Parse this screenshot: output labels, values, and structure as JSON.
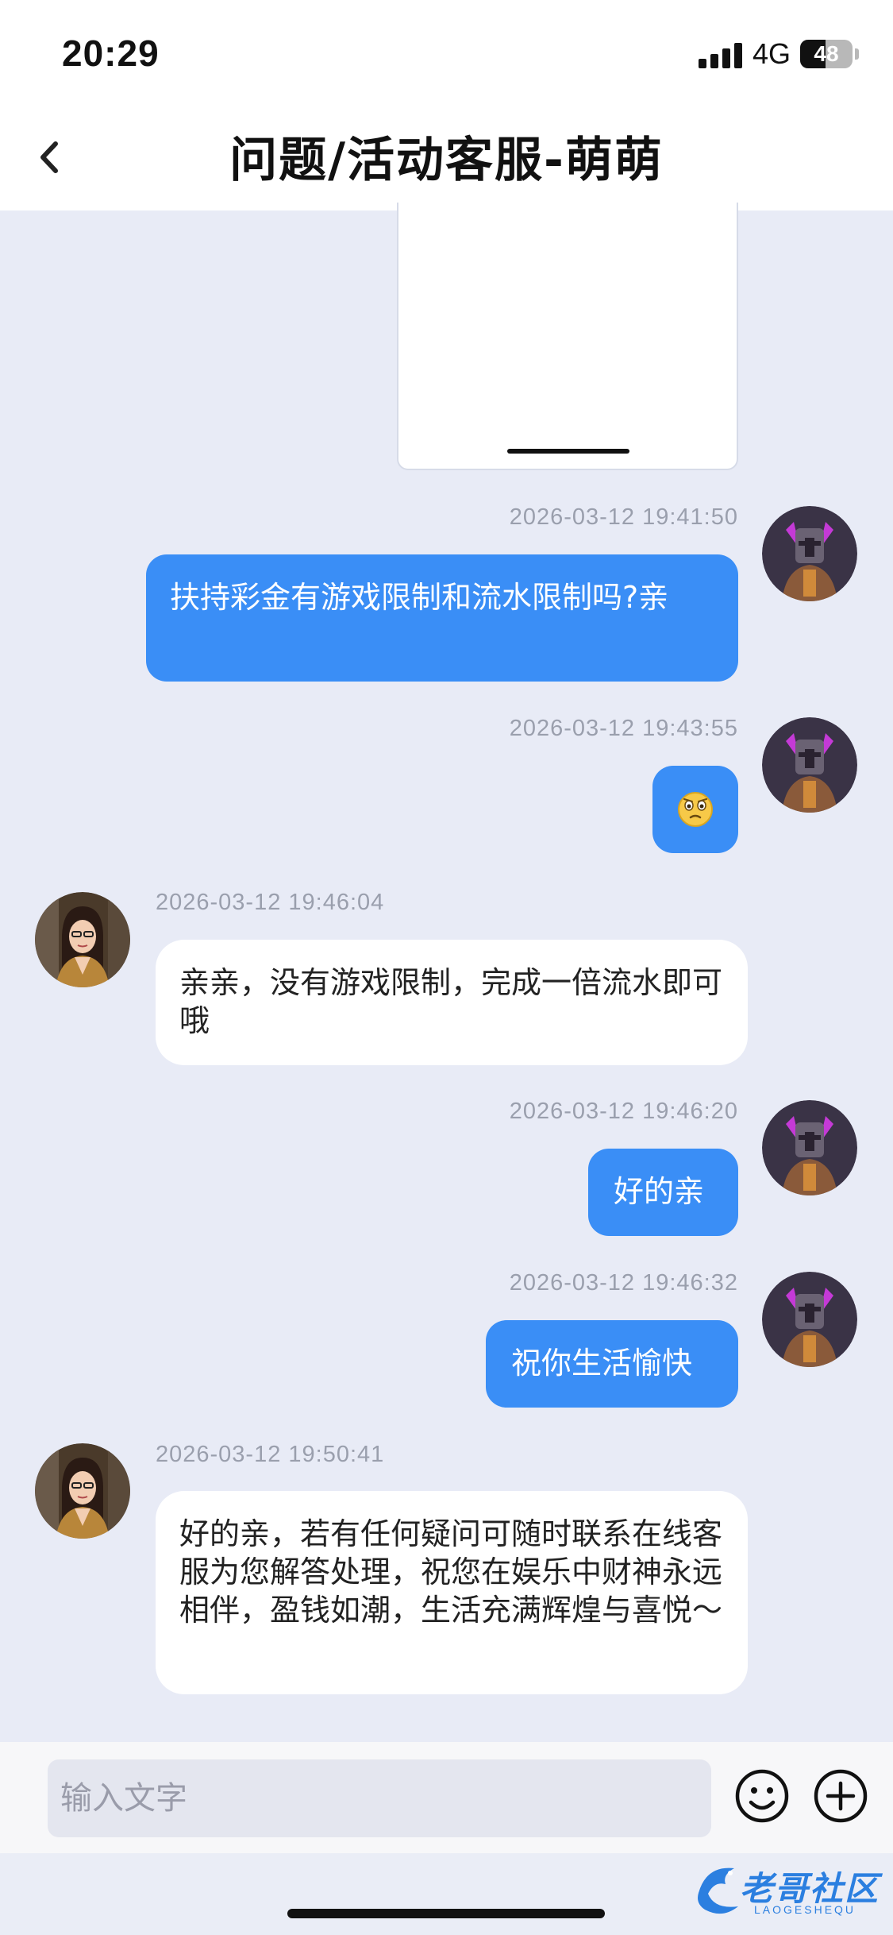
{
  "status_bar": {
    "time": "20:29",
    "network": "4G",
    "battery": "48",
    "battery_level": 0.48
  },
  "header": {
    "title": "问题/活动客服-萌萌",
    "back_icon": "chevron-left-icon"
  },
  "messages": [
    {
      "side": "out",
      "timestamp": "2026-03-12 19:41:50",
      "text": "扶持彩金有游戏限制和流水限制吗?亲"
    },
    {
      "side": "out",
      "timestamp": "2026-03-12 19:43:55",
      "text": "",
      "emoji": "confused-face-emoji"
    },
    {
      "side": "in",
      "timestamp": "2026-03-12 19:46:04",
      "text": "亲亲，没有游戏限制，完成一倍流水即可哦"
    },
    {
      "side": "out",
      "timestamp": "2026-03-12 19:46:20",
      "text": "好的亲"
    },
    {
      "side": "out",
      "timestamp": "2026-03-12 19:46:32",
      "text": "祝你生活愉快"
    },
    {
      "side": "in",
      "timestamp": "2026-03-12 19:50:41",
      "text": "好的亲，若有任何疑问可随时联系在线客服为您解答处理，祝您在娱乐中财神永远相伴，盈钱如潮，生活充满辉煌与喜悦～"
    }
  ],
  "input": {
    "placeholder": "输入文字",
    "value": ""
  },
  "watermark": {
    "text": "老哥社区",
    "sub": "LAOGESHEQU"
  },
  "colors": {
    "accent": "#3a8ef6",
    "chat_bg": "#e8ebf6",
    "timestamp": "#9a9fad"
  }
}
